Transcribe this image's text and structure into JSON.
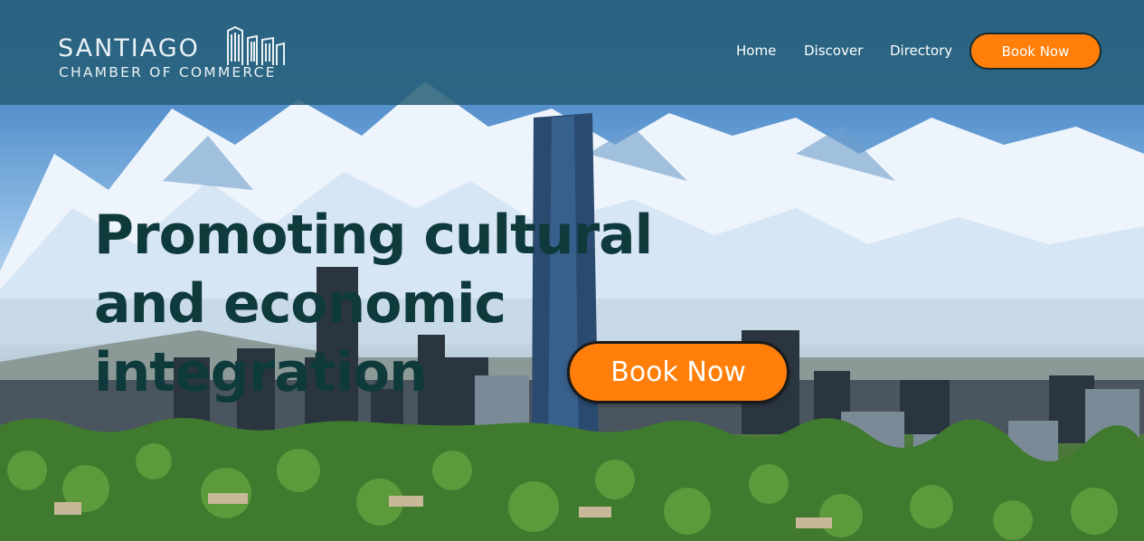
{
  "brand": {
    "name": "SANTIAGO",
    "tagline": "CHAMBER OF COMMERCE"
  },
  "nav": {
    "items": [
      {
        "label": "Home"
      },
      {
        "label": "Discover"
      },
      {
        "label": "Directory"
      }
    ],
    "book_label": "Book Now"
  },
  "hero": {
    "headline": "Promoting cultural and economic integration",
    "cta_label": "Book Now",
    "background": "santiago-skyline-andes-photo"
  },
  "colors": {
    "header": "#266078",
    "accent": "#ff7f0a",
    "headline": "#0f3a3c"
  },
  "icons": {
    "logo": "city-buildings-icon",
    "theme_toggle": "moon-icon"
  }
}
